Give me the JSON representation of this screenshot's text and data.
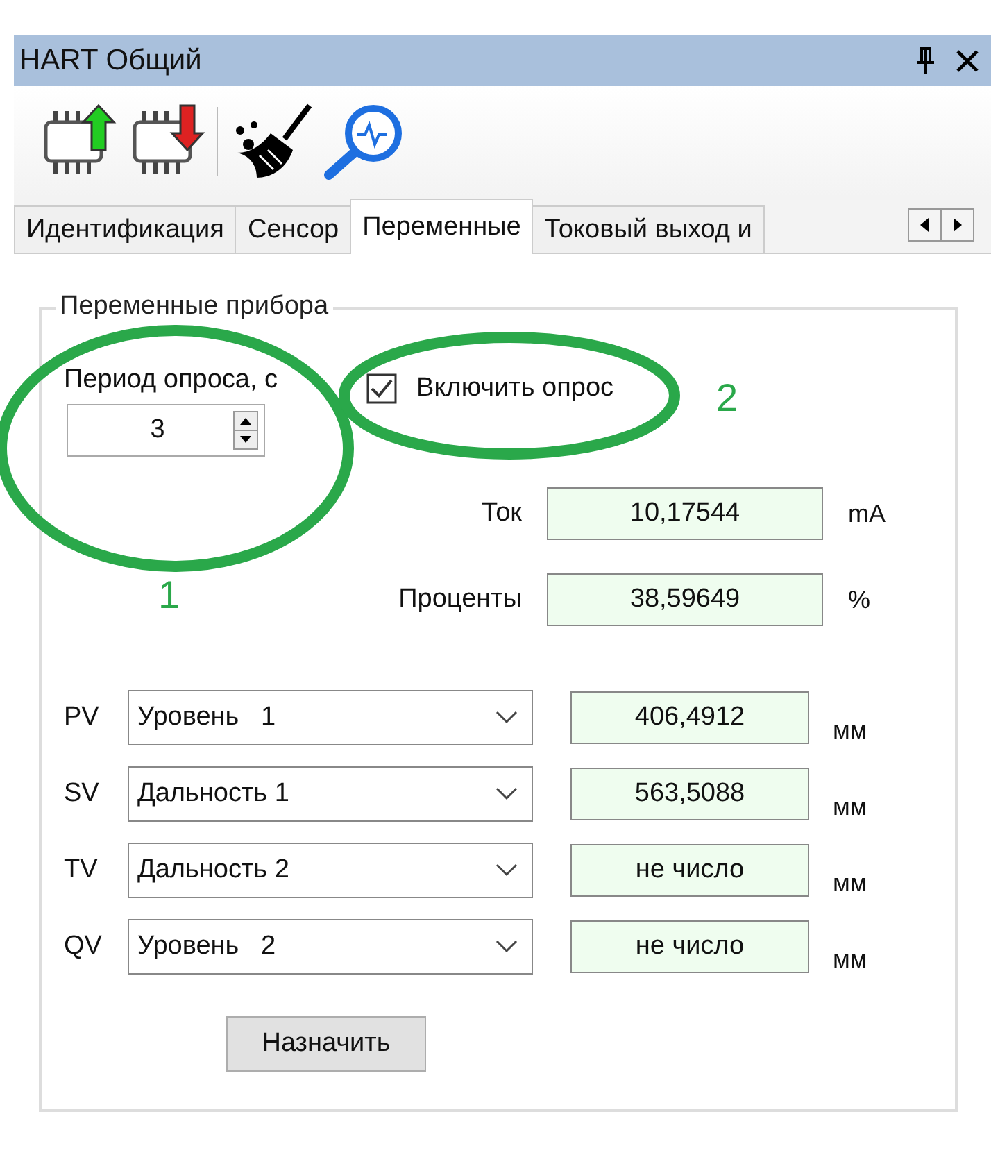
{
  "window": {
    "title": "HART Общий"
  },
  "tabs": [
    {
      "label": "Идентификация",
      "selected": false
    },
    {
      "label": "Сенсор",
      "selected": false
    },
    {
      "label": "Переменные",
      "selected": true
    },
    {
      "label": "Токовый выход и",
      "selected": false
    }
  ],
  "group": {
    "legend": "Переменные прибора",
    "poll_period": {
      "label": "Период опроса, с",
      "value": "3"
    },
    "poll_enable": {
      "label": "Включить опрос",
      "checked": true
    },
    "readings": [
      {
        "label": "Ток",
        "value": "10,17544",
        "unit": "mA"
      },
      {
        "label": "Проценты",
        "value": "38,59649",
        "unit": "%"
      }
    ],
    "variables": [
      {
        "name": "PV",
        "selection": "Уровень   1",
        "value": "406,4912",
        "unit": "мм"
      },
      {
        "name": "SV",
        "selection": "Дальность 1",
        "value": "563,5088",
        "unit": "мм"
      },
      {
        "name": "TV",
        "selection": "Дальность 2",
        "value": "не число",
        "unit": "мм"
      },
      {
        "name": "QV",
        "selection": "Уровень   2",
        "value": "не число",
        "unit": "мм"
      }
    ],
    "assign_button": "Назначить"
  },
  "annotations": [
    {
      "label": "1"
    },
    {
      "label": "2"
    }
  ]
}
